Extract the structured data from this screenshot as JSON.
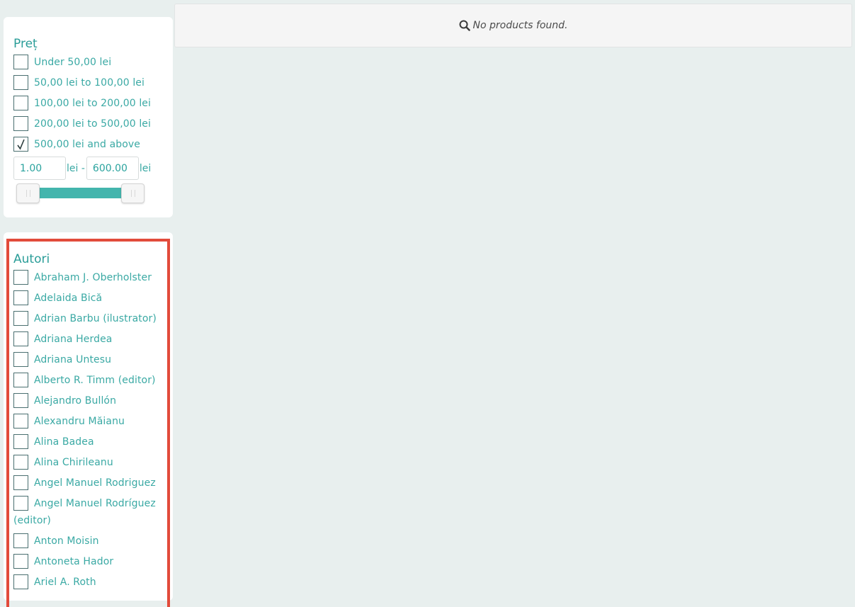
{
  "price_filter": {
    "title": "Preț",
    "options": [
      {
        "label": "Under 50,00 lei",
        "checked": false
      },
      {
        "label": "50,00 lei to 100,00 lei",
        "checked": false
      },
      {
        "label": "100,00 lei to 200,00 lei",
        "checked": false
      },
      {
        "label": "200,00 lei to 500,00 lei",
        "checked": false
      },
      {
        "label": "500,00 lei and above",
        "checked": true
      }
    ],
    "min_value": "1.00",
    "max_value": "600.00",
    "unit_min": "lei -",
    "unit_max": "lei"
  },
  "authors_filter": {
    "title": "Autori",
    "options": [
      {
        "label": "Abraham J. Oberholster"
      },
      {
        "label": "Adelaida Bică"
      },
      {
        "label": "Adrian Barbu (ilustrator)"
      },
      {
        "label": "Adriana Herdea"
      },
      {
        "label": "Adriana Untesu"
      },
      {
        "label": "Alberto R. Timm (editor)"
      },
      {
        "label": "Alejandro Bullón"
      },
      {
        "label": "Alexandru Măianu"
      },
      {
        "label": "Alina Badea"
      },
      {
        "label": "Alina Chirileanu"
      },
      {
        "label": "Angel Manuel Rodriguez"
      },
      {
        "label": "Angel Manuel Rodríguez (editor)"
      },
      {
        "label": "Anton Moisin"
      },
      {
        "label": "Antoneta Hador"
      },
      {
        "label": "Ariel A. Roth"
      }
    ]
  },
  "results": {
    "message": "No products found.",
    "icon": "search-icon"
  },
  "colors": {
    "accent": "#3aa9a4",
    "highlight": "#e24b3b",
    "slider": "#43b5ad"
  }
}
